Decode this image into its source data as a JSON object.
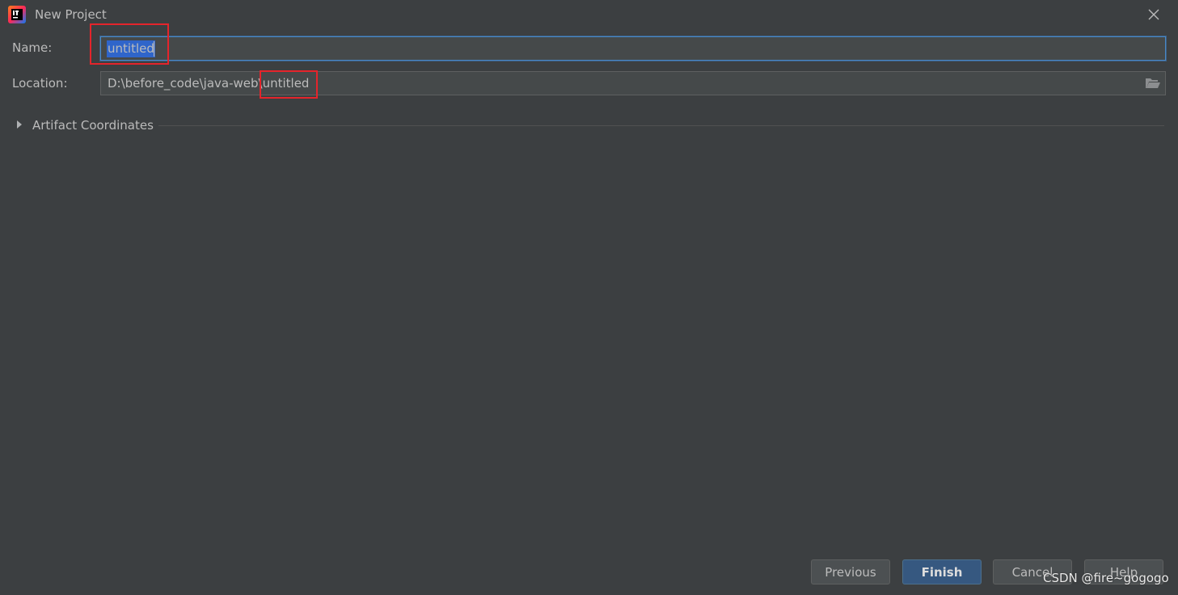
{
  "window": {
    "title": "New Project",
    "icon": "intellij-idea-icon"
  },
  "form": {
    "name_label": "Name:",
    "name_value": "untitled",
    "location_label": "Location:",
    "location_prefix": "D:\\before_code\\java-web\\",
    "location_suffix": "untitled"
  },
  "sections": {
    "artifact_coordinates": "Artifact Coordinates"
  },
  "buttons": {
    "previous": "Previous",
    "finish": "Finish",
    "cancel": "Cancel",
    "help": "Help"
  },
  "watermark": "CSDN @fire~gogogo",
  "colors": {
    "background": "#3c3f41",
    "field": "#45494a",
    "selection": "#2f65ca",
    "focus_border": "#4a88c7",
    "primary_button": "#365880",
    "annotation": "#e5242b"
  }
}
